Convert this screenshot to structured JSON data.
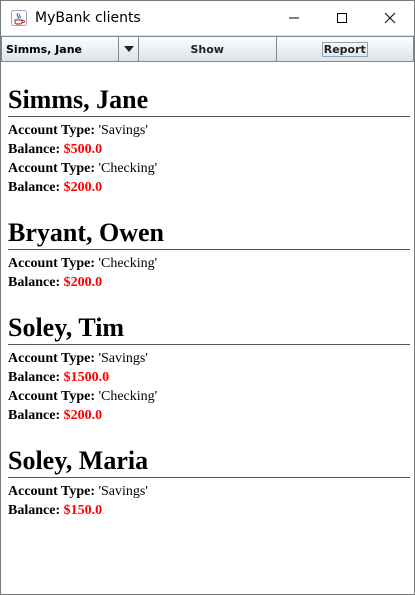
{
  "window": {
    "title": "MyBank clients",
    "app_icon": "java-icon"
  },
  "toolbar": {
    "client_select_value": "Simms, Jane",
    "show_label": "Show",
    "report_label": "Report"
  },
  "labels": {
    "account_type": "Account Type:",
    "balance": "Balance:"
  },
  "clients": [
    {
      "name": "Simms, Jane",
      "accounts": [
        {
          "type": "'Savings'",
          "balance": "$500.0"
        },
        {
          "type": "'Checking'",
          "balance": "$200.0"
        }
      ]
    },
    {
      "name": "Bryant, Owen",
      "accounts": [
        {
          "type": "'Checking'",
          "balance": "$200.0"
        }
      ]
    },
    {
      "name": "Soley, Tim",
      "accounts": [
        {
          "type": "'Savings'",
          "balance": "$1500.0"
        },
        {
          "type": "'Checking'",
          "balance": "$200.0"
        }
      ]
    },
    {
      "name": "Soley, Maria",
      "accounts": [
        {
          "type": "'Savings'",
          "balance": "$150.0"
        }
      ]
    }
  ],
  "colors": {
    "balance": "#ff0000"
  }
}
